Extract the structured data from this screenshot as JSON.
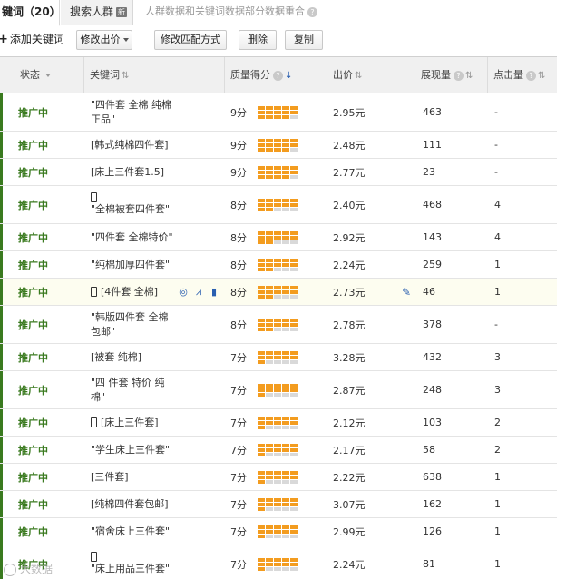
{
  "tabs": {
    "keywords": "键词（20）",
    "crowd": "搜索人群",
    "crowd_badge": "新",
    "notice": "人群数据和关键词数据部分数据重合"
  },
  "toolbar": {
    "add": "添加关键词",
    "modify_bid": "修改出价",
    "modify_match": "修改匹配方式",
    "delete": "删除",
    "copy": "复制"
  },
  "columns": {
    "status": "状态",
    "keyword": "关键词",
    "quality": "质量得分",
    "bid": "出价",
    "impressions": "展现量",
    "clicks": "点击量"
  },
  "rows": [
    {
      "status": "推广中",
      "mobile": false,
      "keyword": "\"四件套 全棉 纯棉正品\"",
      "score": "9分",
      "level": 9,
      "bid": "2.95元",
      "impressions": "463",
      "clicks": "-",
      "lines": 2
    },
    {
      "status": "推广中",
      "mobile": false,
      "keyword": "[韩式纯棉四件套]",
      "score": "9分",
      "level": 9,
      "bid": "2.48元",
      "impressions": "111",
      "clicks": "-",
      "lines": 1
    },
    {
      "status": "推广中",
      "mobile": false,
      "keyword": "[床上三件套1.5]",
      "score": "9分",
      "level": 9,
      "bid": "2.77元",
      "impressions": "23",
      "clicks": "-",
      "lines": 1
    },
    {
      "status": "推广中",
      "mobile": true,
      "keyword": "\"全棉被套四件套\"",
      "score": "8分",
      "level": 8,
      "bid": "2.40元",
      "impressions": "468",
      "clicks": "4",
      "lines": 2
    },
    {
      "status": "推广中",
      "mobile": false,
      "keyword": "\"四件套 全棉特价\"",
      "score": "8分",
      "level": 8,
      "bid": "2.92元",
      "impressions": "143",
      "clicks": "4",
      "lines": 1
    },
    {
      "status": "推广中",
      "mobile": false,
      "keyword": "\"纯棉加厚四件套\"",
      "score": "8分",
      "level": 8,
      "bid": "2.24元",
      "impressions": "259",
      "clicks": "1",
      "lines": 1
    },
    {
      "status": "推广中",
      "mobile": true,
      "keyword": "[4件套 全棉]",
      "score": "8分",
      "level": 8,
      "bid": "2.73元",
      "impressions": "46",
      "clicks": "1",
      "lines": 1,
      "highlight": true
    },
    {
      "status": "推广中",
      "mobile": false,
      "keyword": "\"韩版四件套 全棉包邮\"",
      "score": "8分",
      "level": 8,
      "bid": "2.78元",
      "impressions": "378",
      "clicks": "-",
      "lines": 2
    },
    {
      "status": "推广中",
      "mobile": false,
      "keyword": "[被套 纯棉]",
      "score": "7分",
      "level": 7,
      "bid": "3.28元",
      "impressions": "432",
      "clicks": "3",
      "lines": 1
    },
    {
      "status": "推广中",
      "mobile": false,
      "keyword": "\"四 件套 特价 纯棉\"",
      "score": "7分",
      "level": 7,
      "bid": "2.87元",
      "impressions": "248",
      "clicks": "3",
      "lines": 2
    },
    {
      "status": "推广中",
      "mobile": true,
      "keyword": "[床上三件套]",
      "score": "7分",
      "level": 7,
      "bid": "2.12元",
      "impressions": "103",
      "clicks": "2",
      "lines": 1
    },
    {
      "status": "推广中",
      "mobile": false,
      "keyword": "\"学生床上三件套\"",
      "score": "7分",
      "level": 7,
      "bid": "2.17元",
      "impressions": "58",
      "clicks": "2",
      "lines": 1
    },
    {
      "status": "推广中",
      "mobile": false,
      "keyword": "[三件套]",
      "score": "7分",
      "level": 7,
      "bid": "2.22元",
      "impressions": "638",
      "clicks": "1",
      "lines": 1
    },
    {
      "status": "推广中",
      "mobile": false,
      "keyword": "[纯棉四件套包邮]",
      "score": "7分",
      "level": 7,
      "bid": "3.07元",
      "impressions": "162",
      "clicks": "1",
      "lines": 1
    },
    {
      "status": "推广中",
      "mobile": false,
      "keyword": "\"宿舍床上三件套\"",
      "score": "7分",
      "level": 7,
      "bid": "2.99元",
      "impressions": "126",
      "clicks": "1",
      "lines": 1
    },
    {
      "status": "推广中",
      "mobile": true,
      "keyword": "\"床上用品三件套\"",
      "score": "7分",
      "level": 7,
      "bid": "2.24元",
      "impressions": "81",
      "clicks": "1",
      "lines": 2
    }
  ],
  "watermark": "大数据"
}
